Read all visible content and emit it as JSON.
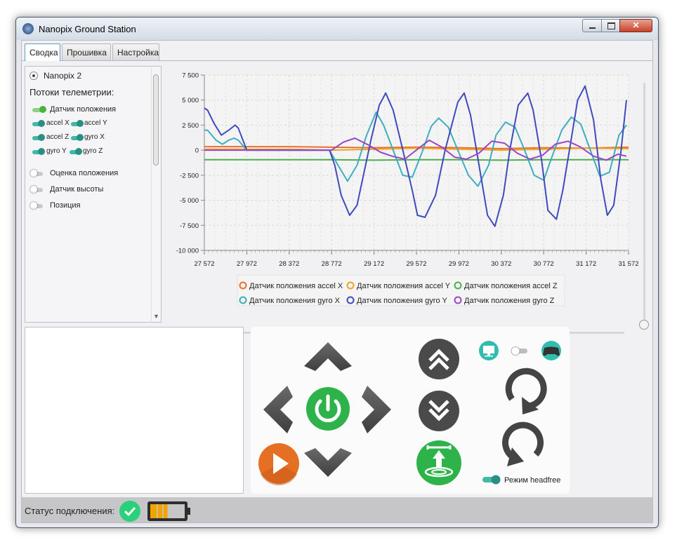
{
  "window": {
    "title": "Nanopix Ground Station"
  },
  "tabs": [
    {
      "label": "Сводка"
    },
    {
      "label": "Прошивка"
    },
    {
      "label": "Настройка"
    }
  ],
  "sidebar": {
    "device": "Nanopix 2",
    "streams_title": "Потоки телеметрии:",
    "position_sensor": "Датчик положения",
    "sub": [
      "accel X",
      "accel Y",
      "accel Z",
      "gyro X",
      "gyro Y",
      "gyro Z"
    ],
    "others": [
      "Оценка положения",
      "Датчик высоты",
      "Позиция"
    ]
  },
  "chart_data": {
    "type": "line",
    "x_ticks": [
      "27 572",
      "27 972",
      "28 372",
      "28 772",
      "29 172",
      "29 572",
      "29 972",
      "30 372",
      "30 772",
      "31 172",
      "31 572"
    ],
    "y_ticks": [
      "7 500",
      "5 000",
      "2 500",
      "0",
      "-2 500",
      "-5 000",
      "-7 500",
      "-10 000"
    ],
    "xlim": [
      27572,
      31572
    ],
    "ylim": [
      -10000,
      7500
    ],
    "grid": true,
    "legend_position": "bottom",
    "series": [
      {
        "name": "Датчик положения accel X",
        "color": "#e8702a",
        "x": [
          27572,
          27972,
          28372,
          28772,
          29172,
          29572,
          29972,
          30372,
          30772,
          31172,
          31572
        ],
        "values": [
          350,
          350,
          350,
          300,
          250,
          300,
          250,
          150,
          250,
          200,
          300
        ]
      },
      {
        "name": "Датчик положения accel Y",
        "color": "#f0a424",
        "x": [
          27572,
          27972,
          28372,
          28772,
          29172,
          29572,
          29972,
          30372,
          30772,
          31172,
          31572
        ],
        "values": [
          100,
          100,
          100,
          0,
          100,
          200,
          100,
          0,
          100,
          200,
          150
        ]
      },
      {
        "name": "Датчик положения accel Z",
        "color": "#4cae4c",
        "x": [
          27572,
          27972,
          28372,
          28772,
          29172,
          29572,
          29972,
          30372,
          30772,
          31172,
          31572
        ],
        "values": [
          -950,
          -950,
          -950,
          -950,
          -1000,
          -950,
          -950,
          -1000,
          -950,
          -950,
          -950
        ]
      },
      {
        "name": "Датчик положения gyro X",
        "color": "#3eaec0",
        "x": [
          27572,
          27602,
          27682,
          27742,
          27802,
          27852,
          27892,
          27972,
          28372,
          28752,
          28832,
          28922,
          29012,
          29102,
          29192,
          29262,
          29352,
          29442,
          29532,
          29622,
          29712,
          29782,
          29872,
          29962,
          30062,
          30152,
          30252,
          30322,
          30412,
          30502,
          30592,
          30682,
          30772,
          30852,
          30942,
          31032,
          31122,
          31212,
          31302,
          31392,
          31482,
          31552
        ],
        "values": [
          2000,
          2000,
          1000,
          600,
          1000,
          1200,
          1000,
          0,
          0,
          0,
          -1500,
          -3100,
          -1500,
          1500,
          3800,
          2500,
          0,
          -2500,
          -2700,
          -300,
          2400,
          3200,
          2300,
          0,
          -2500,
          -3600,
          -1500,
          1500,
          2800,
          2300,
          0,
          -2500,
          -3000,
          -600,
          2000,
          3300,
          2600,
          0,
          -2600,
          -2200,
          1500,
          2500
        ]
      },
      {
        "name": "Датчик положения gyro Y",
        "color": "#3e4bbd",
        "x": [
          27572,
          27602,
          27662,
          27732,
          27802,
          27862,
          27892,
          27972,
          28372,
          28752,
          28802,
          28862,
          28942,
          29012,
          29072,
          29142,
          29222,
          29282,
          29352,
          29432,
          29532,
          29582,
          29652,
          29752,
          29842,
          29962,
          30022,
          30082,
          30162,
          30242,
          30312,
          30392,
          30452,
          30532,
          30622,
          30672,
          30752,
          30812,
          30892,
          30952,
          31022,
          31092,
          31162,
          31242,
          31312,
          31372,
          31432,
          31502,
          31552
        ],
        "values": [
          4200,
          4000,
          2700,
          1500,
          2000,
          2500,
          2200,
          0,
          0,
          0,
          -1500,
          -4500,
          -6500,
          -5500,
          -2500,
          1000,
          4500,
          5700,
          4000,
          500,
          -4000,
          -6500,
          -6700,
          -4500,
          0,
          4800,
          5700,
          3500,
          -1500,
          -6500,
          -7600,
          -4500,
          0,
          4500,
          5700,
          4000,
          -1000,
          -6000,
          -6900,
          -4000,
          500,
          5000,
          6400,
          3000,
          -3000,
          -6500,
          -5500,
          0,
          5000
        ]
      },
      {
        "name": "Датчик положения gyro Z",
        "color": "#9b45c8",
        "x": [
          27572,
          27972,
          28372,
          28772,
          28882,
          28992,
          29122,
          29232,
          29342,
          29462,
          29582,
          29692,
          29812,
          29932,
          30042,
          30162,
          30282,
          30402,
          30522,
          30642,
          30762,
          30882,
          31002,
          31122,
          31242,
          31362,
          31472,
          31552
        ],
        "values": [
          0,
          0,
          0,
          0,
          800,
          1200,
          500,
          -200,
          -600,
          -900,
          100,
          1000,
          300,
          -700,
          -900,
          -300,
          900,
          700,
          -300,
          -900,
          -500,
          600,
          900,
          300,
          -600,
          -1000,
          -400,
          -600
        ]
      }
    ]
  },
  "controls": {
    "headfree_label": "Режим headfree",
    "up_arrow_color": "#4a4a4a",
    "power_color": "#2db34a",
    "play_color": "#e56f22",
    "takeoff_color": "#2db34a",
    "toggle_color": "#2aa89b"
  },
  "status": {
    "label": "Статус подключения:",
    "connected_color": "#2bd17a",
    "battery_color": "#f0a400",
    "battery_level": 0.5
  }
}
